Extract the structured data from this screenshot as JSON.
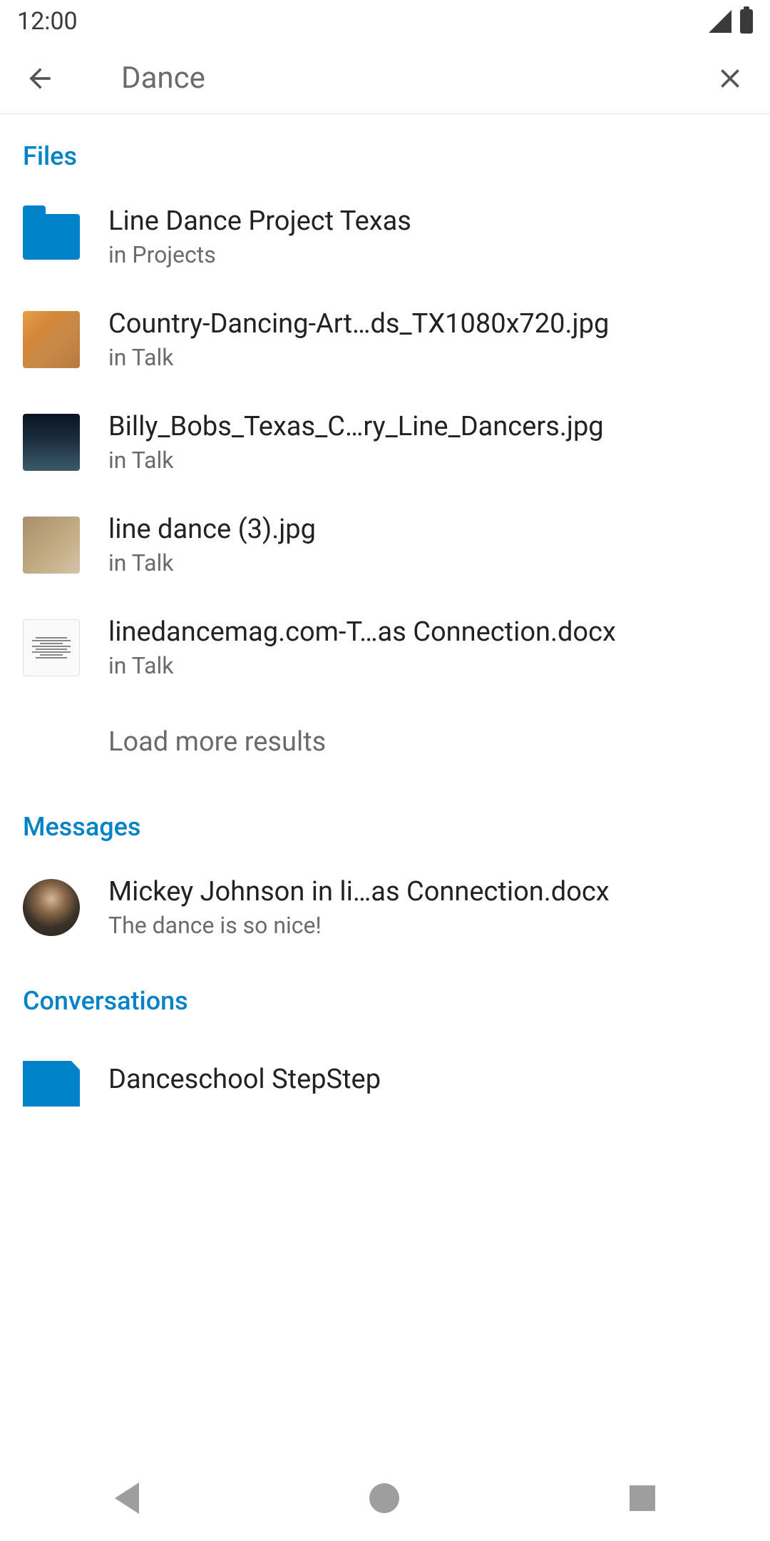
{
  "status": {
    "time": "12:00"
  },
  "search": {
    "query": "Dance"
  },
  "sections": {
    "files": {
      "header": "Files",
      "items": [
        {
          "title": "Line Dance Project Texas",
          "subtitle": "in Projects"
        },
        {
          "title": "Country-Dancing-Art…ds_TX1080x720.jpg",
          "subtitle": "in Talk"
        },
        {
          "title": "Billy_Bobs_Texas_C…ry_Line_Dancers.jpg",
          "subtitle": "in Talk"
        },
        {
          "title": "line dance (3).jpg",
          "subtitle": "in Talk"
        },
        {
          "title": "linedancemag.com-T…as Connection.docx",
          "subtitle": "in Talk"
        }
      ],
      "load_more": "Load more results"
    },
    "messages": {
      "header": "Messages",
      "items": [
        {
          "title": "Mickey Johnson in li…as Connection.docx",
          "subtitle": "The dance is so nice!"
        }
      ]
    },
    "conversations": {
      "header": "Conversations",
      "items": [
        {
          "title": "Danceschool StepStep"
        }
      ]
    }
  }
}
